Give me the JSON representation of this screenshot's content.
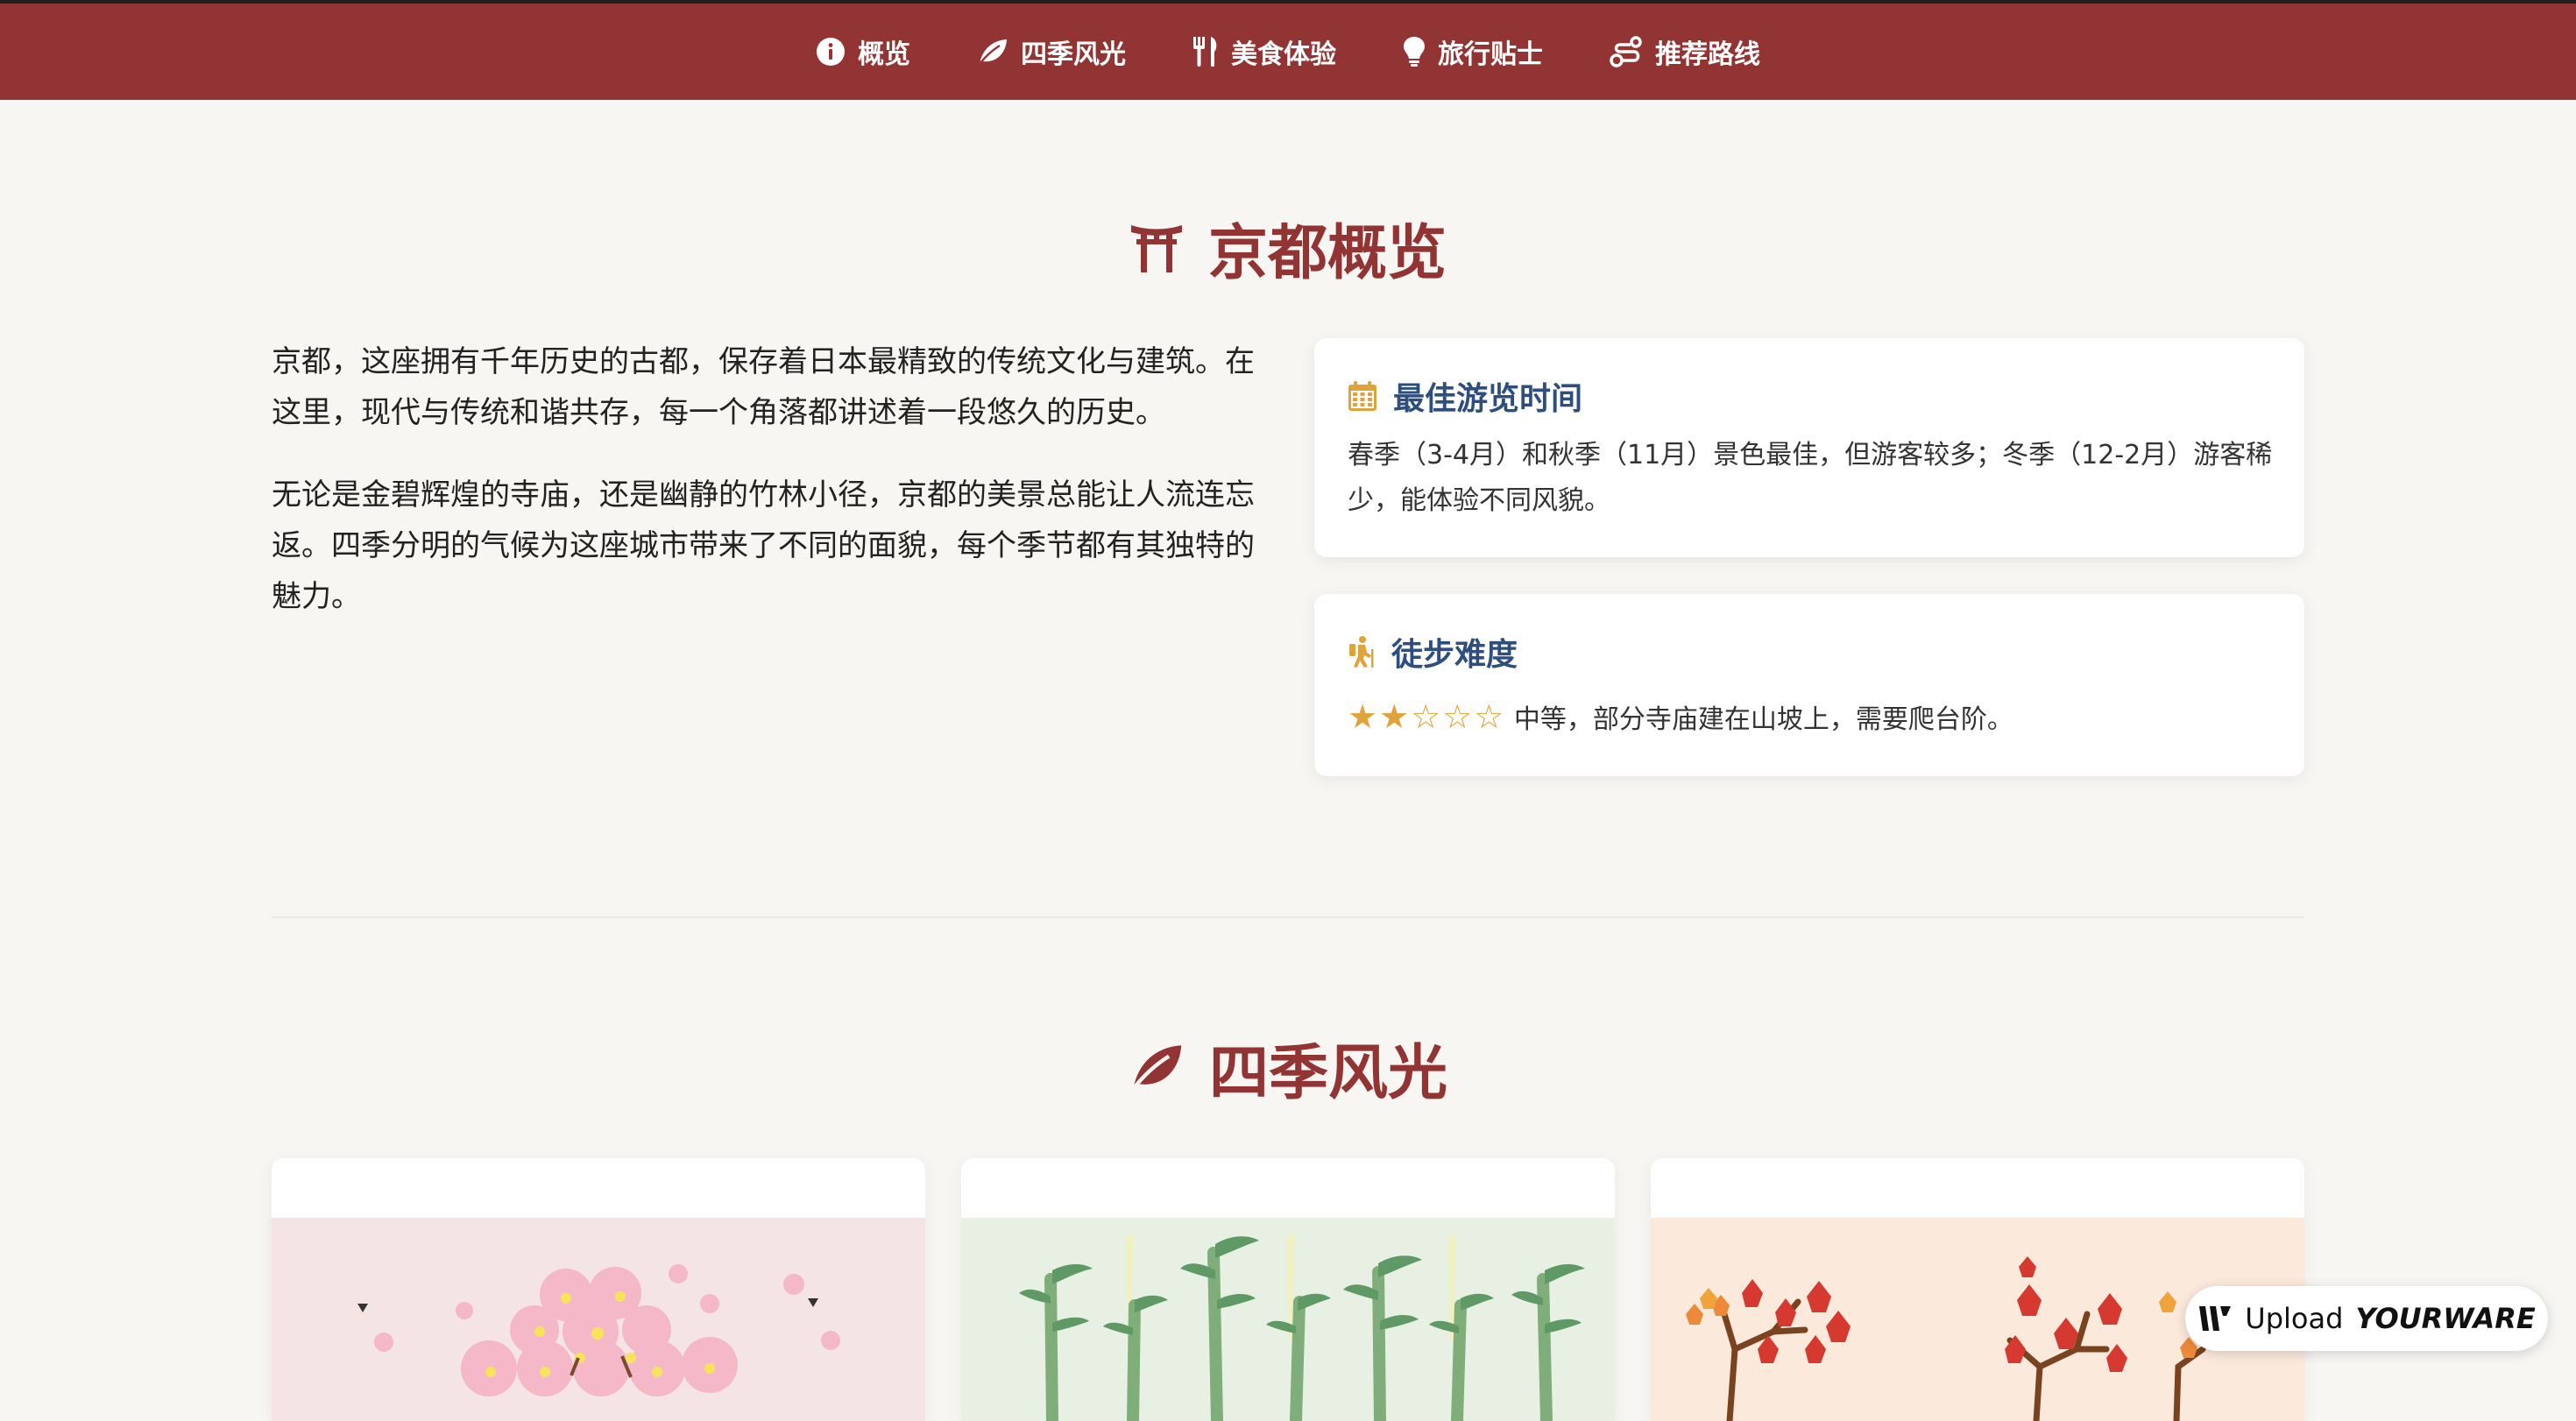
{
  "nav": {
    "items": [
      {
        "label": "概览",
        "icon": "info-circle-icon"
      },
      {
        "label": "四季风光",
        "icon": "leaf-icon"
      },
      {
        "label": "美食体验",
        "icon": "utensils-icon"
      },
      {
        "label": "旅行贴士",
        "icon": "lightbulb-icon"
      },
      {
        "label": "推荐路线",
        "icon": "route-icon"
      }
    ]
  },
  "overview": {
    "title": "京都概览",
    "icon": "torii-gate-icon",
    "paragraphs": [
      "京都，这座拥有千年历史的古都，保存着日本最精致的传统文化与建筑。在这里，现代与传统和谐共存，每一个角落都讲述着一段悠久的历史。",
      "无论是金碧辉煌的寺庙，还是幽静的竹林小径，京都的美景总能让人流连忘返。四季分明的气候为这座城市带来了不同的面貌，每个季节都有其独特的魅力。"
    ],
    "cards": [
      {
        "title": "最佳游览时间",
        "icon": "calendar-icon",
        "text": "春季（3-4月）和秋季（11月）景色最佳，但游客较多；冬季（12-2月）游客稀少，能体验不同风貌。"
      },
      {
        "title": "徒步难度",
        "icon": "hiking-icon",
        "stars": "★★☆☆☆",
        "rating": 2,
        "rating_max": 5,
        "text": "中等，部分寺庙建在山坡上，需要爬台阶。"
      }
    ]
  },
  "seasons": {
    "title": "四季风光",
    "icon": "leaf-icon",
    "cards": [
      {
        "name": "cherry-blossom-illustration",
        "bg": "#f5e4e4"
      },
      {
        "name": "bamboo-illustration",
        "bg": "#e8f0e4"
      },
      {
        "name": "autumn-maple-illustration",
        "bg": "#fbe9dc"
      }
    ]
  },
  "badge": {
    "upload": "Upload",
    "brand": "YOURWARE"
  },
  "colors": {
    "nav_bg": "#923434",
    "accent": "#923434",
    "card_title": "#2e4f7d",
    "icon_gold": "#e0a23a",
    "page_bg": "#f8f6f2"
  }
}
